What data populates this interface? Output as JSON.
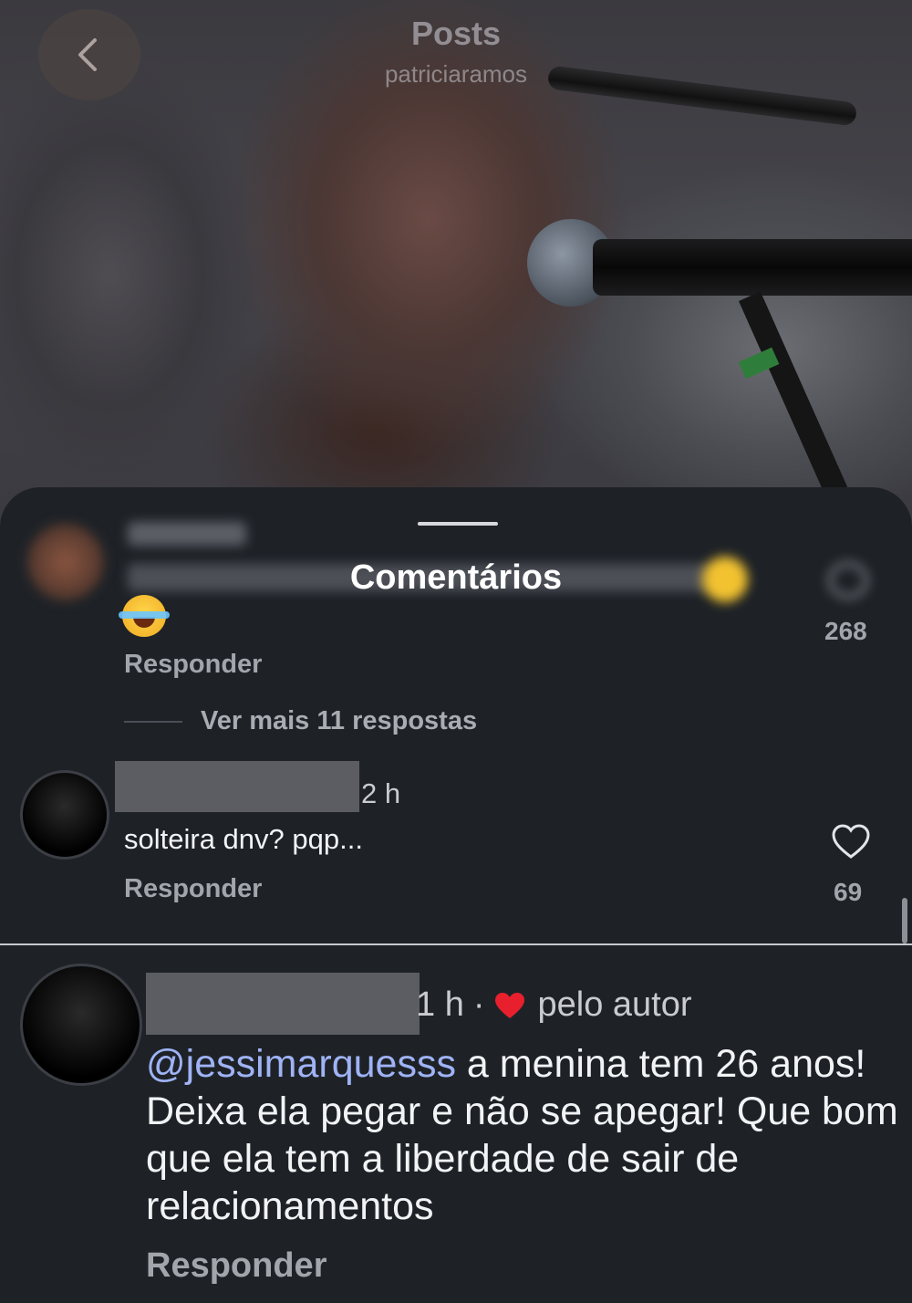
{
  "header": {
    "title": "Posts",
    "subtitle": "patriciaramos"
  },
  "sheet": {
    "title": "Comentários"
  },
  "previous_comment": {
    "likes": "268",
    "reply_label": "Responder",
    "more_replies_label": "Ver mais 11 respostas"
  },
  "comment": {
    "time": "2 h",
    "text": "solteira dnv? pqp...",
    "reply_label": "Responder",
    "likes": "69"
  },
  "zoomed_comment": {
    "time": "1 h",
    "separator": "·",
    "liked_by": "pelo autor",
    "mention": "@jessimarquesss",
    "text": " a menina tem 26 anos! Deixa ela pegar e não se apegar! Que bom que ela tem a liberdade de sair de relacionamentos",
    "reply_label": "Responder"
  },
  "colors": {
    "background": "#1e2227",
    "mention": "#9fb3f5",
    "muted_text": "#a2a5ac",
    "heart_red": "#e8202e"
  },
  "icons": {
    "back": "chevron-left-icon",
    "like": "heart-outline-icon",
    "liked_by_author": "heart-filled-icon"
  }
}
